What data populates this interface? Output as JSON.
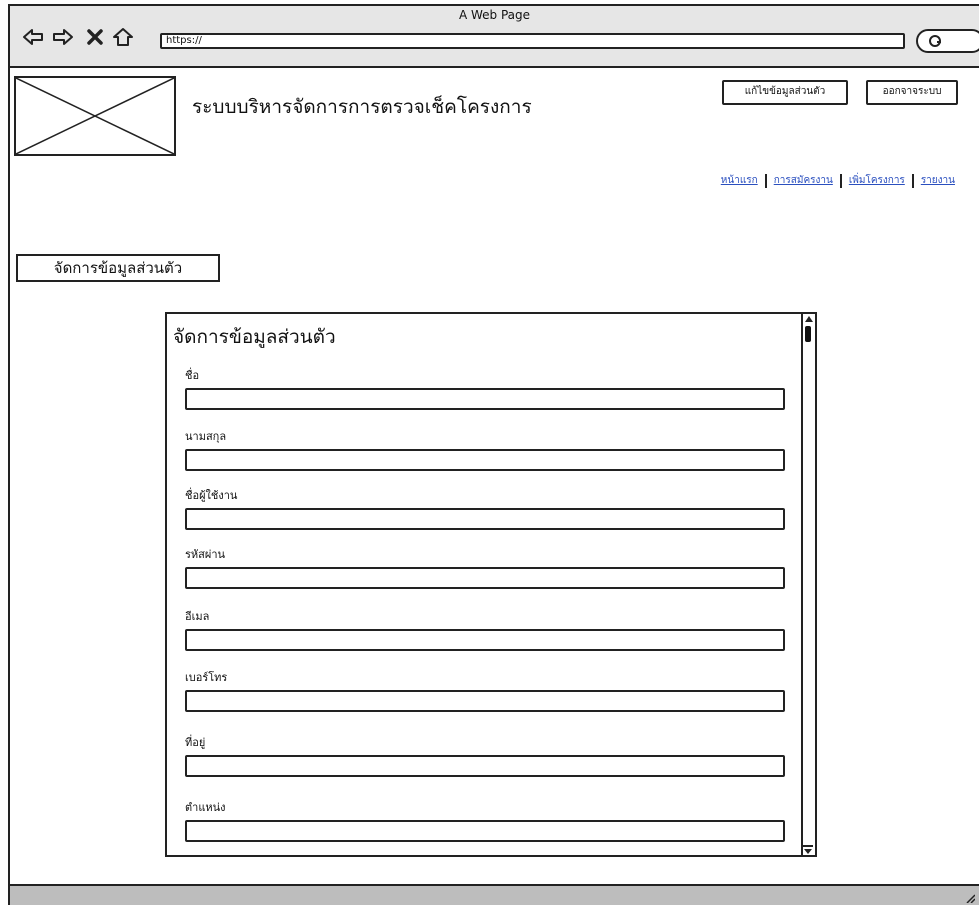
{
  "browser": {
    "window_title": "A Web Page",
    "url": "https://"
  },
  "header": {
    "app_title": "ระบบบริหารจัดการการตรวจเช็คโครงการ",
    "edit_profile_label": "แก้ไขข้อมูลส่วนตัว",
    "logout_label": "ออกจาจระบบ"
  },
  "nav": {
    "links": [
      "หน้าแรก",
      "การสมัครงาน",
      "เพิ่มโครงการ",
      "รายงาน"
    ]
  },
  "section_button": "จัดการข้อมูลส่วนตัว",
  "form": {
    "title": "จัดการข้อมูลส่วนตัว",
    "fields": [
      {
        "label": "ชื่อ",
        "value": ""
      },
      {
        "label": "นามสกุล",
        "value": ""
      },
      {
        "label": "ชื่อผู้ใช้งาน",
        "value": ""
      },
      {
        "label": "รหัสผ่าน",
        "value": ""
      },
      {
        "label": "อีเมล",
        "value": ""
      },
      {
        "label": "เบอร์โทร",
        "value": ""
      },
      {
        "label": "ที่อยู่",
        "value": ""
      },
      {
        "label": "ตำแหน่ง",
        "value": ""
      }
    ]
  }
}
